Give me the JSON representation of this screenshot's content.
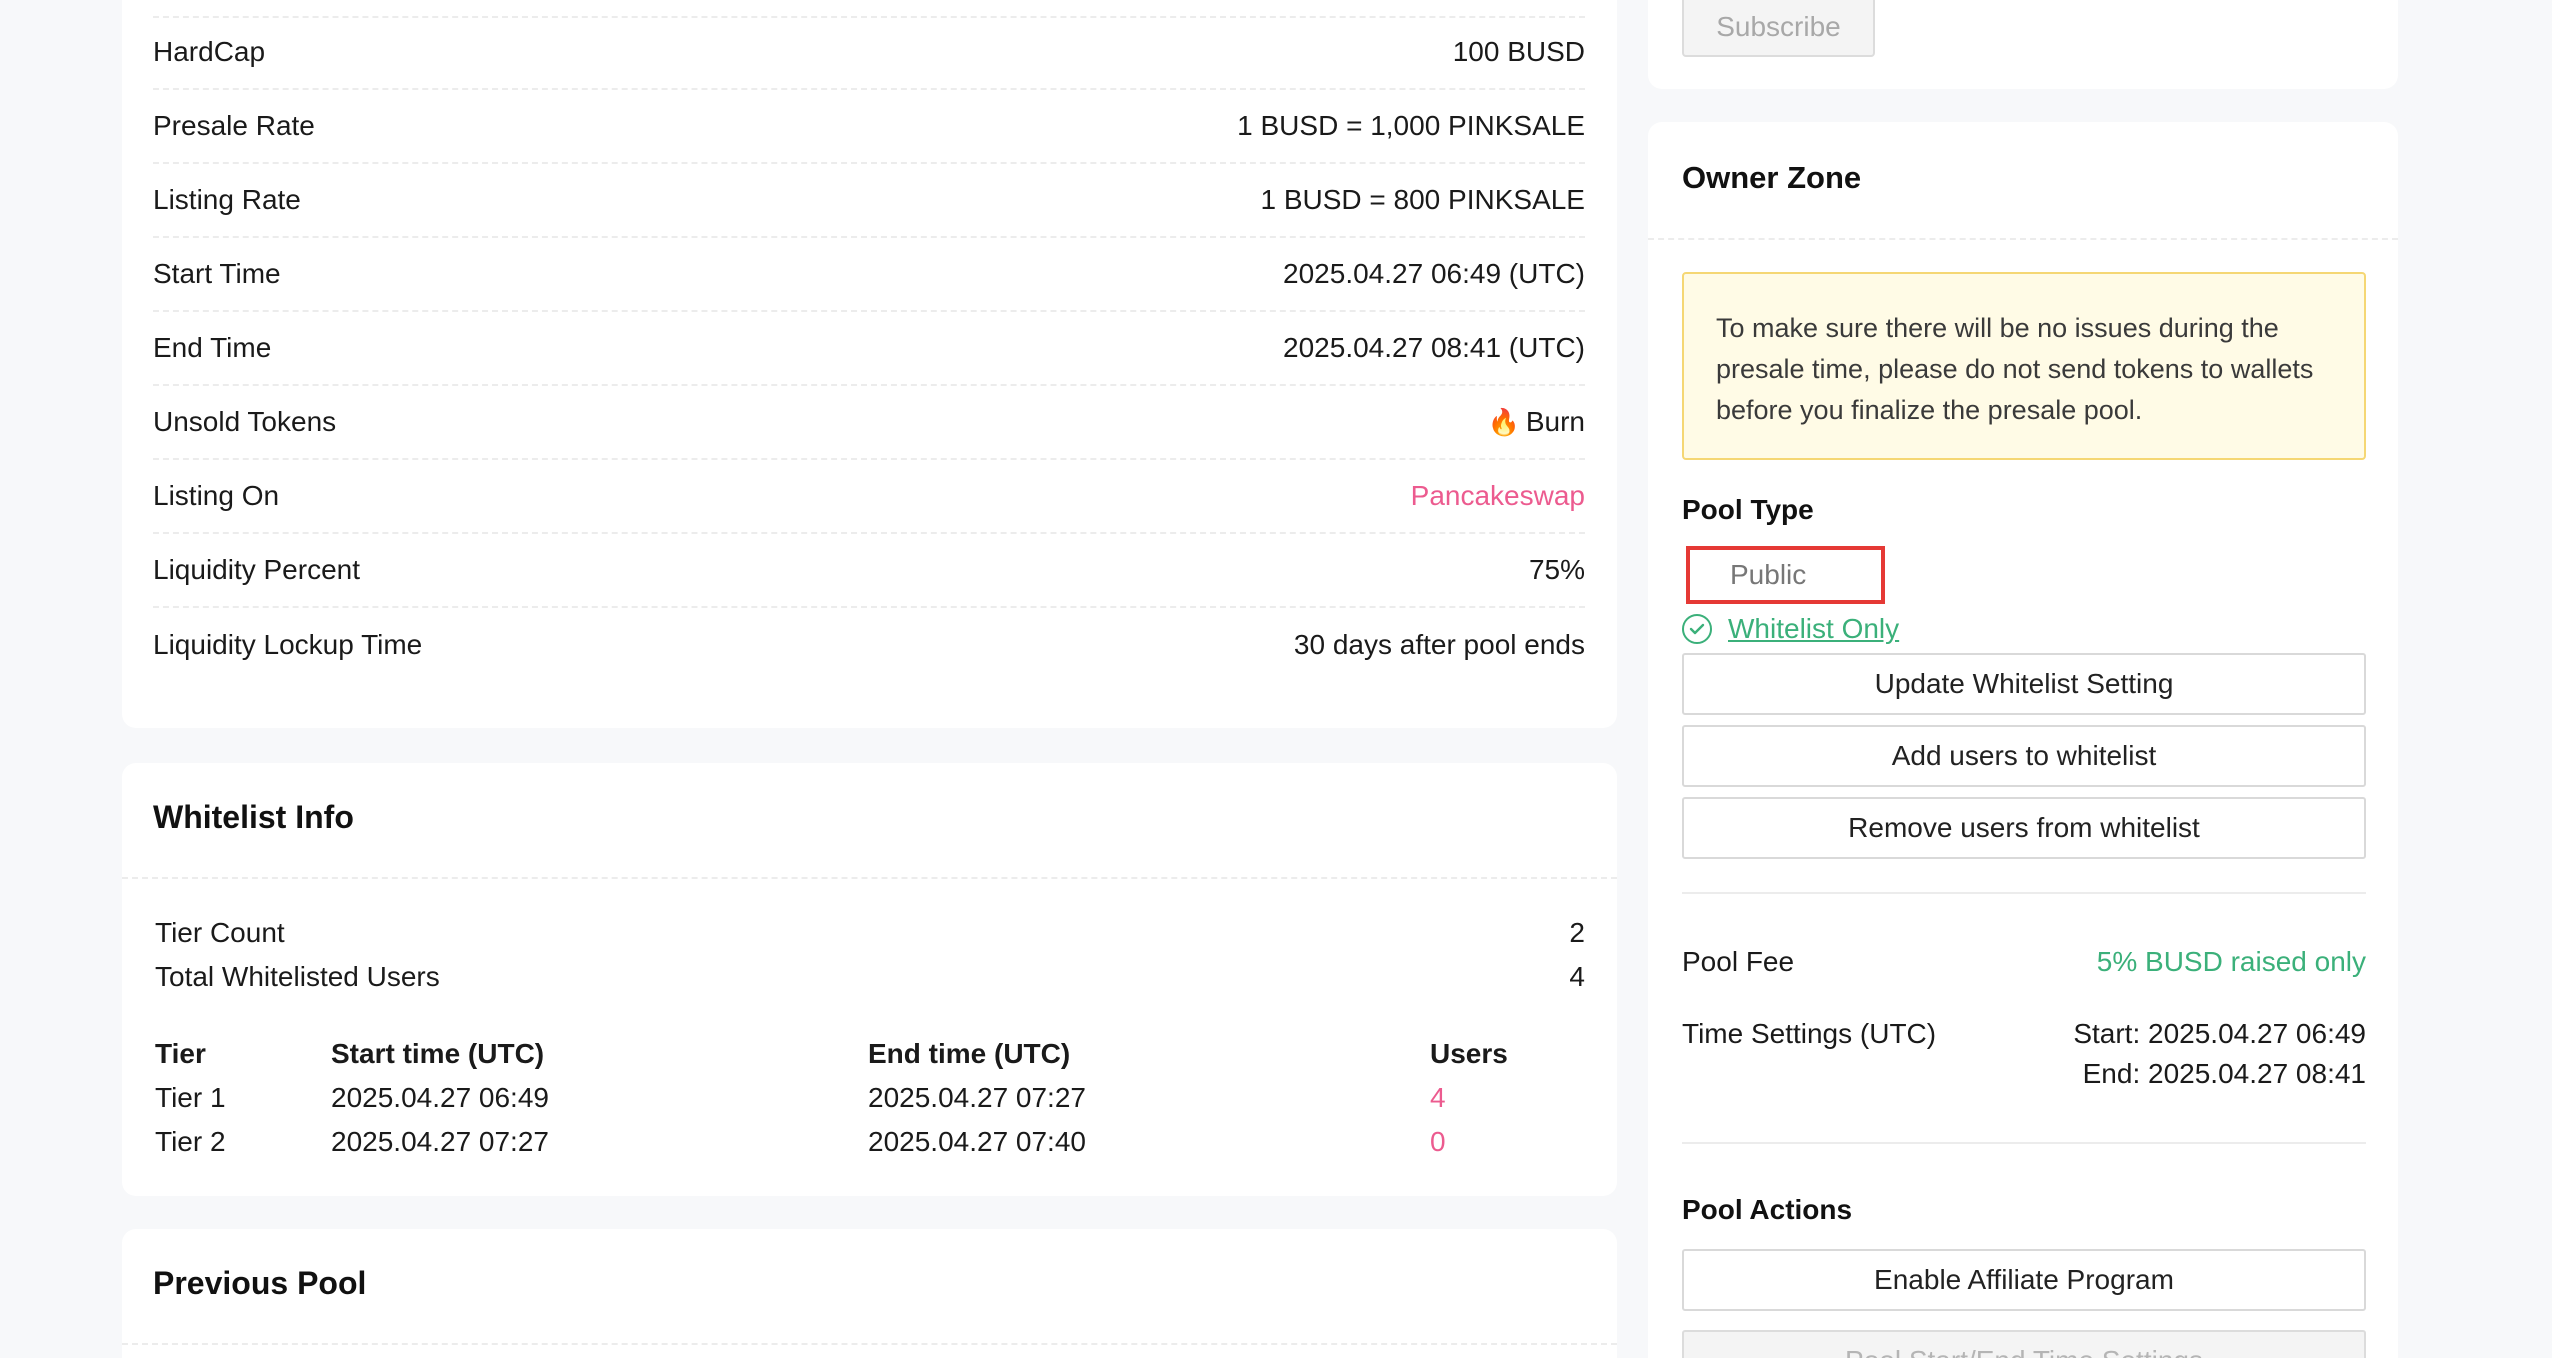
{
  "pool_info": {
    "rows": [
      {
        "label": "HardCap",
        "value": "100 BUSD"
      },
      {
        "label": "Presale Rate",
        "value": "1 BUSD = 1,000 PINKSALE"
      },
      {
        "label": "Listing Rate",
        "value": "1 BUSD = 800 PINKSALE"
      },
      {
        "label": "Start Time",
        "value": "2025.04.27 06:49 (UTC)"
      },
      {
        "label": "End Time",
        "value": "2025.04.27 08:41 (UTC)"
      },
      {
        "label": "Unsold Tokens",
        "value": "Burn",
        "icon": "fire-icon"
      },
      {
        "label": "Listing On",
        "value": "Pancakeswap",
        "link_color": "#ec5b8f"
      },
      {
        "label": "Liquidity Percent",
        "value": "75%"
      },
      {
        "label": "Liquidity Lockup Time",
        "value": "30 days after pool ends"
      }
    ]
  },
  "whitelist_info": {
    "title": "Whitelist Info",
    "tier_count_label": "Tier Count",
    "tier_count_value": "2",
    "total_users_label": "Total Whitelisted Users",
    "total_users_value": "4",
    "columns": [
      "Tier",
      "Start time (UTC)",
      "End time (UTC)",
      "Users"
    ],
    "tiers": [
      {
        "tier": "Tier 1",
        "start": "2025.04.27 06:49",
        "end": "2025.04.27 07:27",
        "users": "4"
      },
      {
        "tier": "Tier 2",
        "start": "2025.04.27 07:27",
        "end": "2025.04.27 07:40",
        "users": "0"
      }
    ]
  },
  "previous_pool": {
    "title": "Previous Pool"
  },
  "subscribe": {
    "button_label": "Subscribe"
  },
  "owner_zone": {
    "title": "Owner Zone",
    "warning": "To make sure there will be no issues during the presale time, please do not send tokens to wallets before you finalize the presale pool.",
    "pool_type_label": "Pool Type",
    "pool_type_options": [
      "Public",
      "Whitelist Only"
    ],
    "pool_type_selected": "Whitelist Only",
    "buttons": [
      "Update Whitelist Setting",
      "Add users to whitelist",
      "Remove users from whitelist"
    ],
    "pool_fee_label": "Pool Fee",
    "pool_fee_value": "5% BUSD raised only",
    "time_settings_label": "Time Settings (UTC)",
    "time_settings_start": "Start: 2025.04.27 06:49",
    "time_settings_end": "End: 2025.04.27 08:41",
    "pool_actions_label": "Pool Actions",
    "enable_affiliate_label": "Enable Affiliate Program",
    "disabled_button_label": "Pool Start/End Time Settings"
  },
  "colors": {
    "accent_pink": "#ec5b8f",
    "accent_green": "#3bb07a",
    "warning_bg": "#fffbe6",
    "highlight_red": "#e53935"
  }
}
